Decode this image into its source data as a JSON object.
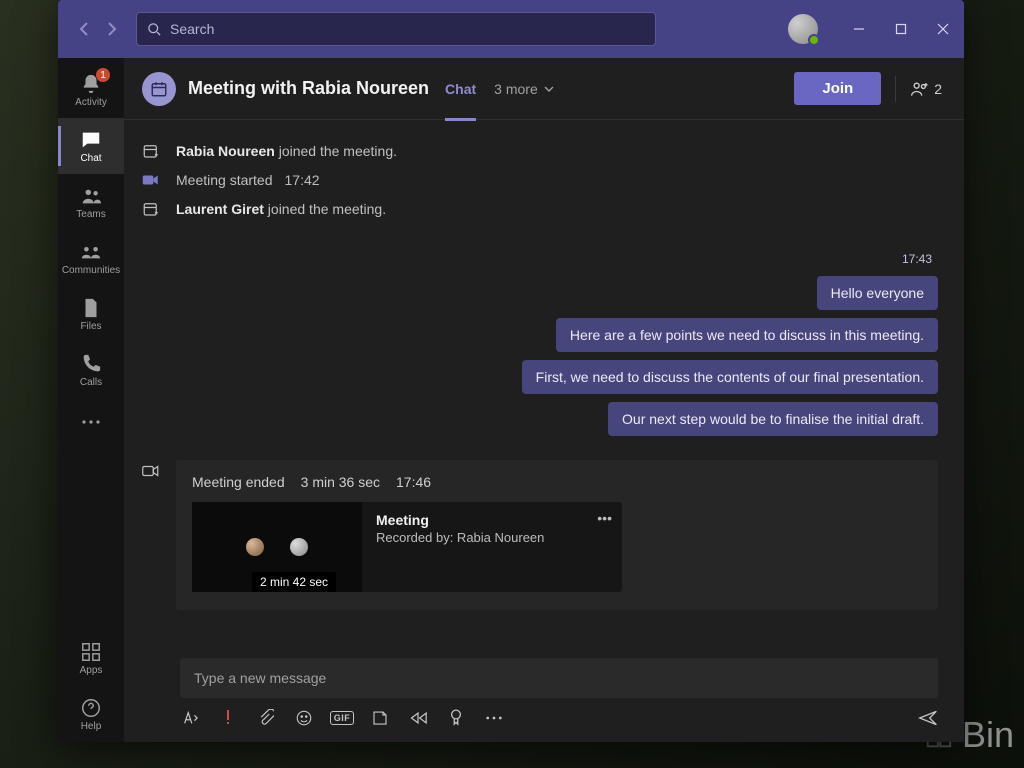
{
  "titlebar": {
    "search_placeholder": "Search"
  },
  "rail": {
    "items": [
      {
        "id": "activity",
        "label": "Activity",
        "badge": "1"
      },
      {
        "id": "chat",
        "label": "Chat"
      },
      {
        "id": "teams",
        "label": "Teams"
      },
      {
        "id": "communities",
        "label": "Communities"
      },
      {
        "id": "files",
        "label": "Files"
      },
      {
        "id": "calls",
        "label": "Calls"
      }
    ],
    "apps_label": "Apps",
    "help_label": "Help"
  },
  "header": {
    "title": "Meeting with Rabia Noureen",
    "tab_chat": "Chat",
    "more_tabs": "3 more",
    "join": "Join",
    "participants_count": "2"
  },
  "events": {
    "joined1_name": "Rabia Noureen",
    "joined1_suffix": " joined the meeting.",
    "started_label": "Meeting started",
    "started_time": "17:42",
    "joined2_name": "Laurent Giret",
    "joined2_suffix": " joined the meeting."
  },
  "out": {
    "time": "17:43",
    "m1": "Hello everyone",
    "m2": "Here are a few points we need to discuss in this meeting.",
    "m3": "First, we need to discuss the contents of our final presentation.",
    "m4": "Our next step would be to finalise the initial draft."
  },
  "ended": {
    "label": "Meeting ended",
    "duration": "3 min 36 sec",
    "time": "17:46",
    "rec_title": "Meeting",
    "rec_by": "Recorded by: Rabia Noureen",
    "rec_len": "2 min 42 sec"
  },
  "composer": {
    "placeholder": "Type a new message"
  },
  "watermark": "Bin"
}
